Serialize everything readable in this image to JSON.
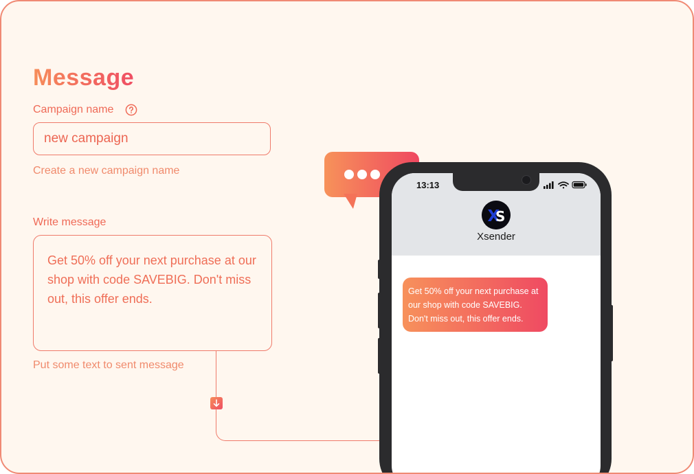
{
  "form": {
    "title": "Message",
    "campaign_label": "Campaign name",
    "campaign_value": "new campaign",
    "campaign_hint": "Create a new campaign name",
    "message_label": "Write message",
    "message_value": "Get 50% off your next purchase at our shop with code SAVEBIG. Don't miss out, this offer ends.",
    "message_hint": "Put some text to sent message"
  },
  "phone": {
    "time": "13:13",
    "contact_name": "Xsender",
    "avatar_text": "XS",
    "message": "Get 50% off your next purchase at our shop with code SAVEBIG. Don't miss out, this offer ends."
  },
  "icons": {
    "help": "help-circle-icon",
    "arrow": "arrow-down-icon",
    "typing": "typing-bubble-icon",
    "signal": "signal-icon",
    "wifi": "wifi-icon",
    "battery": "battery-icon"
  },
  "colors": {
    "accent_start": "#f68d5a",
    "accent_end": "#ef4e63",
    "background": "#fff7ef",
    "border": "#f08a74",
    "phone_frame": "#2b2b2d"
  }
}
